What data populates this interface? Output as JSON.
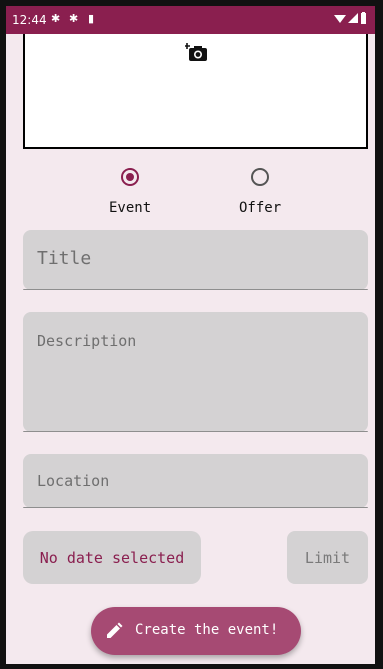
{
  "status_bar": {
    "time": "12:44"
  },
  "image_picker": {
    "icon": "add-a-photo-icon"
  },
  "post_type": {
    "options": [
      {
        "label": "Event",
        "selected": true
      },
      {
        "label": "Offer",
        "selected": false
      }
    ]
  },
  "form": {
    "title_placeholder": "Title",
    "description_placeholder": "Description",
    "location_placeholder": "Location",
    "date_button_label": "No date selected",
    "limit_placeholder": "Limit"
  },
  "fab": {
    "label": "Create the event!",
    "icon": "pencil-icon"
  },
  "colors": {
    "primary": "#8a1f4f",
    "fab": "#a64a73",
    "background": "#f4e9ee",
    "field": "#d4d2d3"
  }
}
